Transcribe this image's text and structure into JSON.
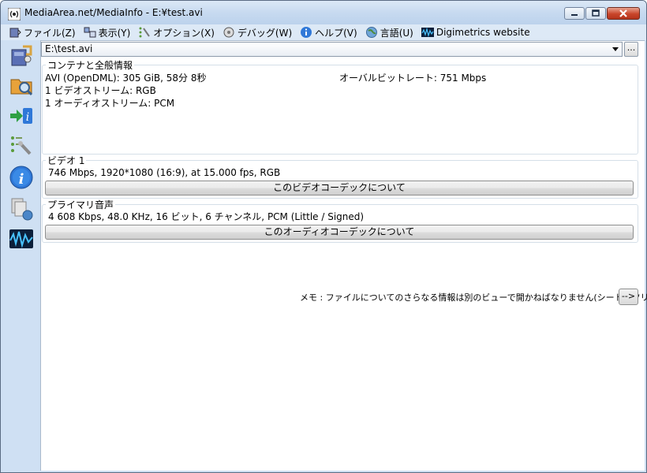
{
  "window": {
    "title": "MediaArea.net/MediaInfo - E:¥test.avi"
  },
  "menu": [
    {
      "label": "ファイル(Z)",
      "icon": "file-icon"
    },
    {
      "label": "表示(Y)",
      "icon": "view-icon"
    },
    {
      "label": "オプション(X)",
      "icon": "options-icon"
    },
    {
      "label": "デバッグ(W)",
      "icon": "debug-icon"
    },
    {
      "label": "ヘルプ(V)",
      "icon": "help-icon"
    },
    {
      "label": "言語(U)",
      "icon": "globe-icon"
    },
    {
      "label": "Digimetrics website",
      "icon": "digimetrics-icon"
    }
  ],
  "file_selector": {
    "value": "E:\\test.avi",
    "browse_label": "..."
  },
  "general": {
    "title": "コンテナと全般情報",
    "format": "AVI (OpenDML): 305 GiB, 58分 8秒",
    "bitrate": "オーバルビットレート: 751 Mbps",
    "video_streams": "1 ビデオストリーム: RGB",
    "audio_streams": "1 オーディオストリーム: PCM"
  },
  "video": {
    "title": "ビデオ 1",
    "info": "746 Mbps, 1920*1080 (16:9), at 15.000 fps, RGB",
    "codec_button": "このビデオコーデックについて"
  },
  "audio": {
    "title": "プライマリ音声",
    "info": "4 608 Kbps, 48.0 KHz, 16 ビット, 6 チャンネル, PCM (Little / Signed)",
    "codec_button": "このオーディオコーデックについて"
  },
  "memo": {
    "text": "メモ : ファイルについてのさらなる情報は別のビューで開かねばなりません(シート、ツリー...)",
    "button": "-->"
  },
  "colors": {
    "frame": "#cfe0f3",
    "content": "#ffffff",
    "close_button": "#c9452a"
  }
}
